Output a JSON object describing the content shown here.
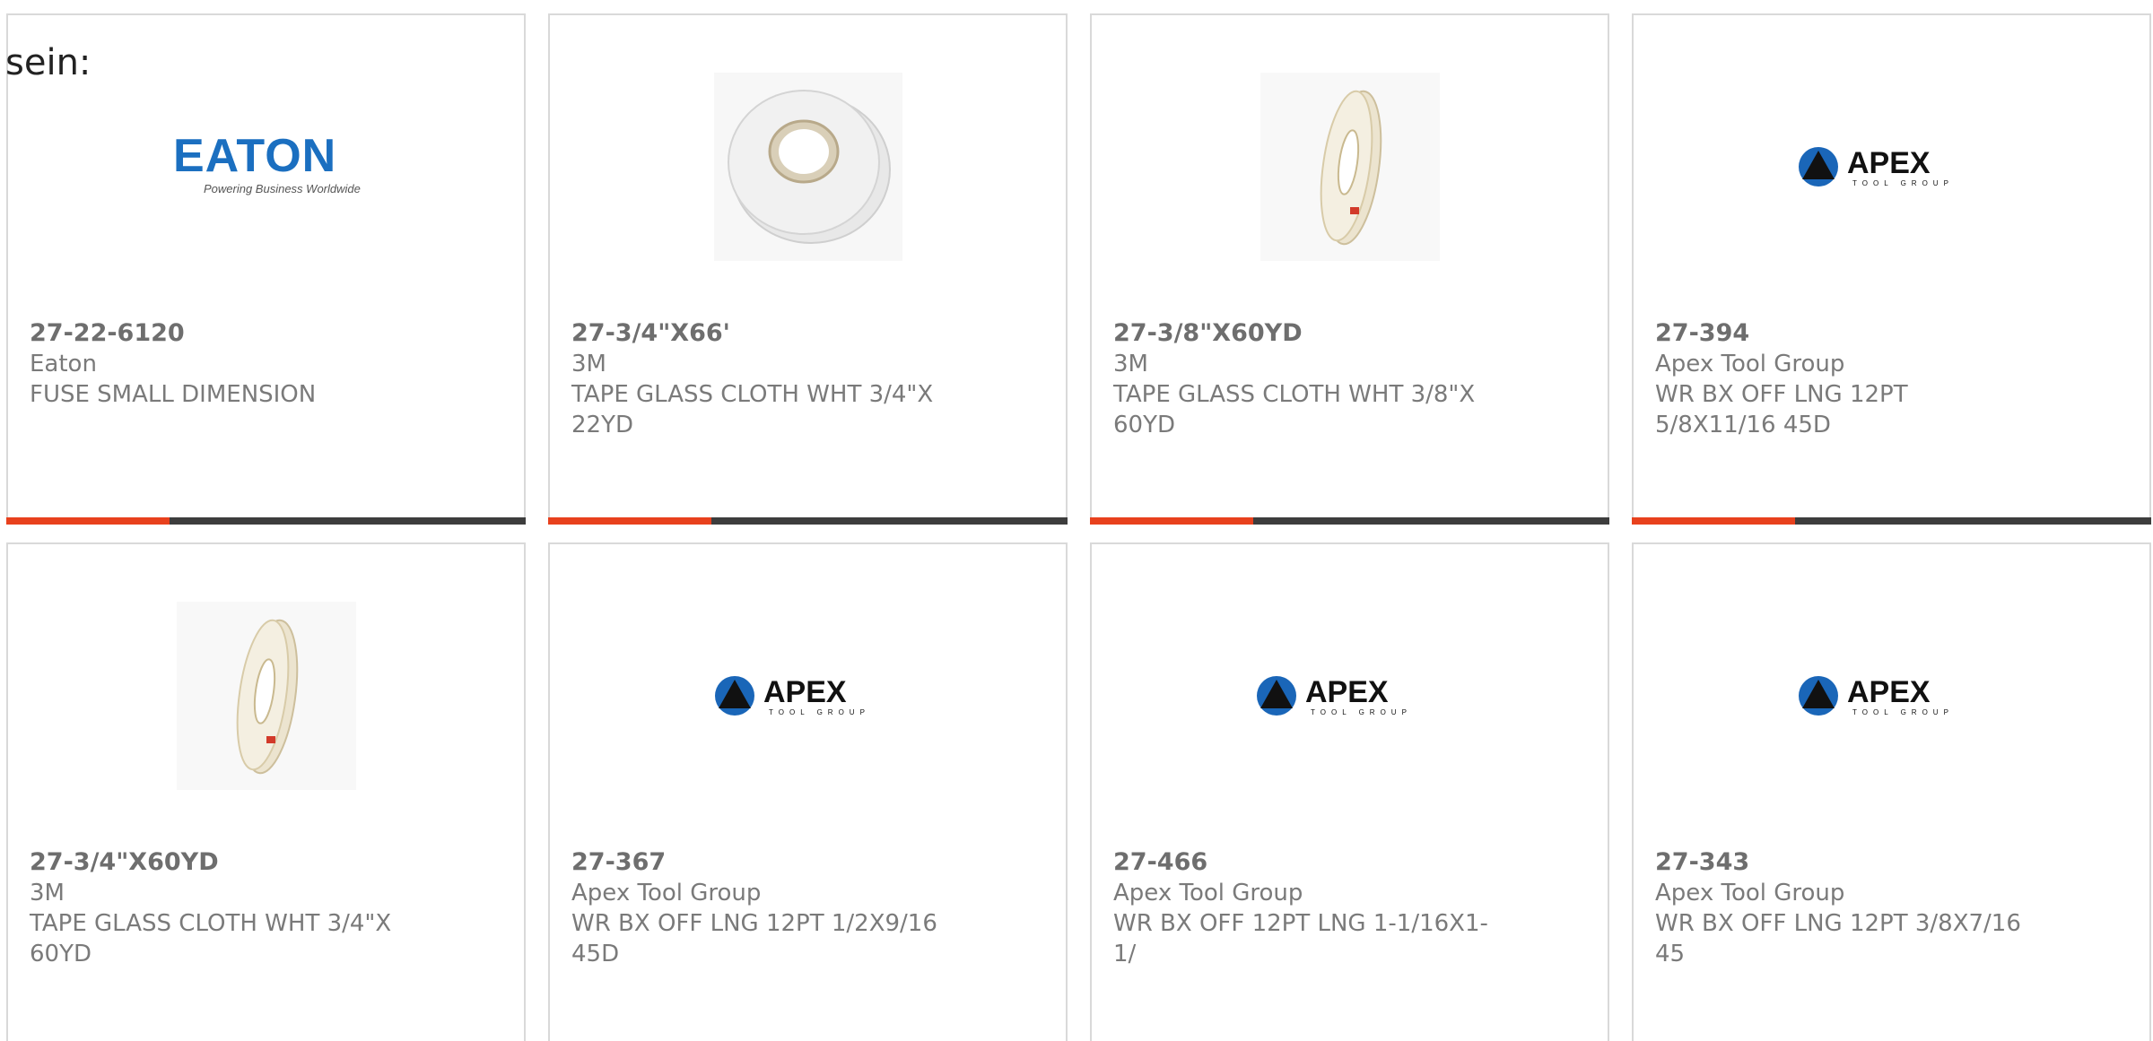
{
  "intro": "sein:",
  "accent_color": "#e8411d",
  "cards": [
    {
      "part": "27-22-6120",
      "manufacturer": "Eaton",
      "description": "FUSE SMALL DIMENSION",
      "image": "eaton-logo",
      "logo_text": "EATON",
      "logo_tagline": "Powering Business Worldwide"
    },
    {
      "part": "27-3/4\"X66'",
      "manufacturer": "3M",
      "description": "TAPE GLASS CLOTH WHT 3/4\"X 22YD",
      "image": "tape-roll-wide"
    },
    {
      "part": "27-3/8\"X60YD",
      "manufacturer": "3M",
      "description": "TAPE GLASS CLOTH WHT 3/8\"X 60YD",
      "image": "tape-roll-narrow"
    },
    {
      "part": "27-394",
      "manufacturer": "Apex Tool Group",
      "description": "WR BX OFF LNG 12PT 5/8X11/16 45D",
      "image": "apex-logo",
      "logo_text": "APEX",
      "logo_tagline": "TOOL GROUP"
    },
    {
      "part": "27-3/4\"X60YD",
      "manufacturer": "3M",
      "description": "TAPE GLASS CLOTH WHT 3/4\"X 60YD",
      "image": "tape-roll-narrow"
    },
    {
      "part": "27-367",
      "manufacturer": "Apex Tool Group",
      "description": "WR BX OFF LNG 12PT 1/2X9/16 45D",
      "image": "apex-logo",
      "logo_text": "APEX",
      "logo_tagline": "TOOL GROUP"
    },
    {
      "part": "27-466",
      "manufacturer": "Apex Tool Group",
      "description": "WR BX OFF 12PT LNG 1-1/16X1- 1/",
      "image": "apex-logo",
      "logo_text": "APEX",
      "logo_tagline": "TOOL GROUP"
    },
    {
      "part": "27-343",
      "manufacturer": "Apex Tool Group",
      "description": "WR BX OFF LNG 12PT 3/8X7/16 45",
      "image": "apex-logo",
      "logo_text": "APEX",
      "logo_tagline": "TOOL GROUP"
    }
  ]
}
